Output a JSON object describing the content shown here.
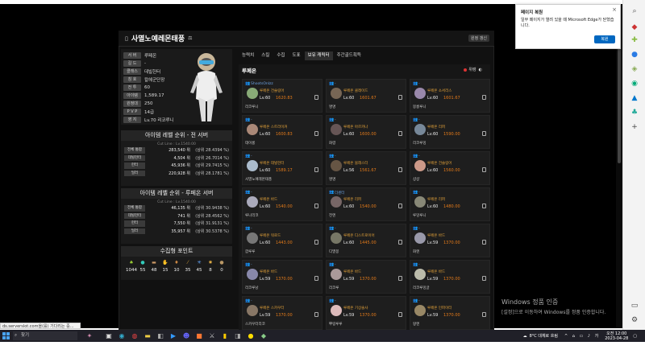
{
  "header": {
    "title": "사멸노예레몬태풍",
    "button": "원정 갱신"
  },
  "info": [
    {
      "k": "서 버",
      "v": "루페온"
    },
    {
      "k": "길 드",
      "v": "-"
    },
    {
      "k": "클래스",
      "v": "데빌헌터"
    },
    {
      "k": "칭 호",
      "v": "칼헤군단장"
    },
    {
      "k": "전 투",
      "v": "60"
    },
    {
      "k": "아이템",
      "v": "1,589.17"
    },
    {
      "k": "원정대",
      "v": "250"
    },
    {
      "k": "P V P",
      "v": "14급"
    },
    {
      "k": "영 지",
      "v": "Lv.70 리코루니"
    }
  ],
  "rank_all": {
    "title": "아이템 레벨 순위 - 전 서버",
    "cut": "Cut Line : Lv.1540.00",
    "rows": [
      {
        "label": "전체 통합",
        "value": "283,540 위",
        "pct": "(상위 28.4394 %)"
      },
      {
        "label": "데빌헌터",
        "value": "4,504 위",
        "pct": "(상위 26.7014 %)"
      },
      {
        "label": "헌터",
        "value": "45,936 위",
        "pct": "(상위 29.7415 %)"
      },
      {
        "label": "딜러",
        "value": "220,928 위",
        "pct": "(상위 28.1781 %)"
      }
    ]
  },
  "rank_server": {
    "title": "아이템 레벨 순위 - 루페온 서버",
    "cut": "Cut Line : Lv.1540.00",
    "rows": [
      {
        "label": "전체 통합",
        "value": "46,135 위",
        "pct": "(상위 30.9438 %)"
      },
      {
        "label": "데빌헌터",
        "value": "741 위",
        "pct": "(상위 28.4562 %)"
      },
      {
        "label": "헌터",
        "value": "7,550 위",
        "pct": "(상위 31.9131 %)"
      },
      {
        "label": "딜러",
        "value": "35,957 위",
        "pct": "(상위 30.5378 %)"
      }
    ]
  },
  "collect": {
    "title": "수집형 포인트",
    "items": [
      {
        "icon": "seed-icon",
        "n": "1044"
      },
      {
        "icon": "island-icon",
        "n": "55"
      },
      {
        "icon": "heart-icon",
        "n": "48"
      },
      {
        "icon": "art-icon",
        "n": "15"
      },
      {
        "icon": "mokoko-icon",
        "n": "10"
      },
      {
        "icon": "star-icon",
        "n": "35"
      },
      {
        "icon": "orb-icon",
        "n": "45"
      },
      {
        "icon": "medal-icon",
        "n": "8"
      },
      {
        "icon": "leaf-icon",
        "n": "0"
      }
    ]
  },
  "tabs": [
    "능력치",
    "스킬",
    "수집",
    "도표",
    "보유 캐릭터",
    "주간골드획득"
  ],
  "roster": {
    "server": "루페온",
    "lock": "위렝",
    "cards": [
      {
        "party": "ShootsOnIzz",
        "cls": "루페온 건슬링어",
        "lv": "Lv.60",
        "il": "1620.83",
        "name": "리코루니"
      },
      {
        "party": "-",
        "cls": "루페온 클레이드",
        "lv": "Lv.60",
        "il": "1601.67",
        "name": "명명"
      },
      {
        "party": "-",
        "cls": "루페온 소서리스",
        "lv": "Lv.60",
        "il": "1601.67",
        "name": "몽롱루니"
      },
      {
        "party": "-",
        "cls": "루페온 스트라이커",
        "lv": "Lv.60",
        "il": "1600.83",
        "name": "데이롱"
      },
      {
        "party": "-",
        "cls": "루페온 아르카나",
        "lv": "Lv.60",
        "il": "1600.00",
        "name": "화령"
      },
      {
        "party": "-",
        "cls": "루페온 리퍼",
        "lv": "Lv.60",
        "il": "1590.00",
        "name": "리코루밍"
      },
      {
        "party": "-",
        "cls": "루페온 데빌헌터",
        "lv": "Lv.60",
        "il": "1589.17",
        "name": "사멸노예레몬태풍"
      },
      {
        "party": "-",
        "cls": "루페온 블래스터",
        "lv": "Lv.56",
        "il": "1561.67",
        "name": "명명"
      },
      {
        "party": "-",
        "cls": "루페온 건슬링어",
        "lv": "Lv.60",
        "il": "1560.00",
        "name": "샹샹"
      },
      {
        "party": "-",
        "cls": "루페온 바드",
        "lv": "Lv.60",
        "il": "1540.00",
        "name": "루나리코"
      },
      {
        "party": "더센터",
        "cls": "루페온 리퍼",
        "lv": "Lv.60",
        "il": "1540.00",
        "name": "전엔"
      },
      {
        "party": "-",
        "cls": "루페온 리퍼",
        "lv": "Lv.60",
        "il": "1480.00",
        "name": "루밍루니"
      },
      {
        "party": "-",
        "cls": "루페온 워로드",
        "lv": "Lv.60",
        "il": "1443.00",
        "name": "깜루루"
      },
      {
        "party": "-",
        "cls": "루페온 디스트로이어",
        "lv": "Lv.60",
        "il": "1445.00",
        "name": "디멸봉"
      },
      {
        "party": "-",
        "cls": "루페온 바드",
        "lv": "Lv.59",
        "il": "1370.00",
        "name": "화엔"
      },
      {
        "party": "-",
        "cls": "루페온 바드",
        "lv": "Lv.59",
        "il": "1370.00",
        "name": "리코루낭"
      },
      {
        "party": "-",
        "cls": "루페온 바드",
        "lv": "Lv.59",
        "il": "1370.00",
        "name": "리코루"
      },
      {
        "party": "-",
        "cls": "루페온 바드",
        "lv": "Lv.59",
        "il": "1370.00",
        "name": "리코루밍글"
      },
      {
        "party": "-",
        "cls": "루페온 스카우터",
        "lv": "Lv.59",
        "il": "1370.00",
        "name": "스카우터리코"
      },
      {
        "party": "-",
        "cls": "루페온 기상술사",
        "lv": "Lv.59",
        "il": "1370.00",
        "name": "뿌링루루"
      },
      {
        "party": "-",
        "cls": "루페온 인파이터",
        "lv": "Lv.59",
        "il": "1370.00",
        "name": "왕엔"
      }
    ]
  },
  "toast": {
    "title": "페이지 복원",
    "text": "일부 페이지가 열려 있을 때 Microsoft Edge가 닫혔습니다.",
    "button": "복원"
  },
  "watermark": {
    "line1": "Windows 정품 인증",
    "line2": "[설정]으로 이동하여 Windows를 정품 인증합니다."
  },
  "status": "ds.serverslot.com을(를) 기다리는 중...",
  "taskbar": {
    "search": "찾기",
    "weather": "8°C 대체로 흐림",
    "time": "오전 12:00",
    "date": "2023-04-28"
  }
}
